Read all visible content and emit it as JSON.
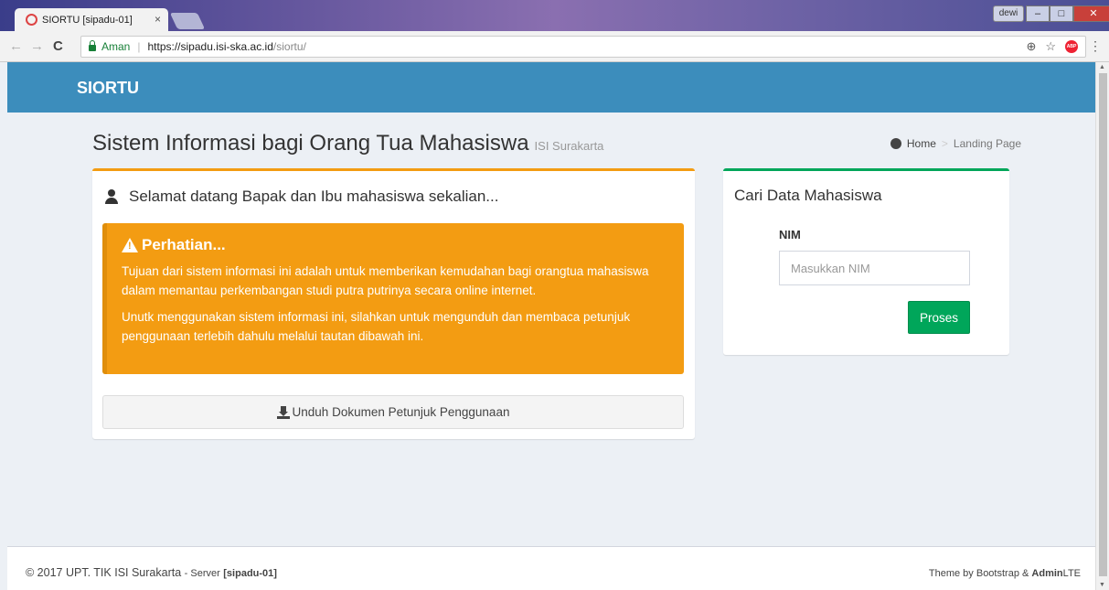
{
  "browser": {
    "tab_title": "SIORTU [sipadu-01]",
    "tab_close": "×",
    "user": "dewi",
    "secure_label": "Aman",
    "url_host": "https://sipadu.isi-ska.ac.id",
    "url_path": "/siortu/"
  },
  "header": {
    "brand": "SIORTU"
  },
  "content": {
    "title": "Sistem Informasi bagi Orang Tua Mahasiswa",
    "subtitle": "ISI Surakarta",
    "breadcrumb": {
      "home": "Home",
      "separator": ">",
      "current": "Landing Page"
    }
  },
  "welcome_box": {
    "heading": "Selamat datang Bapak dan Ibu mahasiswa sekalian...",
    "callout": {
      "title": "Perhatian...",
      "paragraph1": "Tujuan dari sistem informasi ini adalah untuk memberikan kemudahan bagi orangtua mahasiswa dalam memantau perkembangan studi putra putrinya secara online internet.",
      "paragraph2": "Unutk menggunakan sistem informasi ini, silahkan untuk mengunduh dan membaca petunjuk penggunaan terlebih dahulu melalui tautan dibawah ini."
    },
    "download_label": "Unduh Dokumen Petunjuk Penggunaan"
  },
  "search_box": {
    "title": "Cari Data Mahasiswa",
    "nim_label": "NIM",
    "nim_placeholder": "Masukkan NIM",
    "submit_label": "Proses"
  },
  "footer": {
    "copyright": "© 2017 UPT. TIK ISI Surakarta",
    "server_prefix": "- Server",
    "server_name": "[sipadu-01]",
    "theme_prefix": "Theme by Bootstrap &",
    "theme_admin": "Admin",
    "theme_lte": "LTE"
  },
  "colors": {
    "header": "#3c8dbc",
    "warning": "#f39c12",
    "success": "#00a65a",
    "background": "#ecf0f5"
  }
}
